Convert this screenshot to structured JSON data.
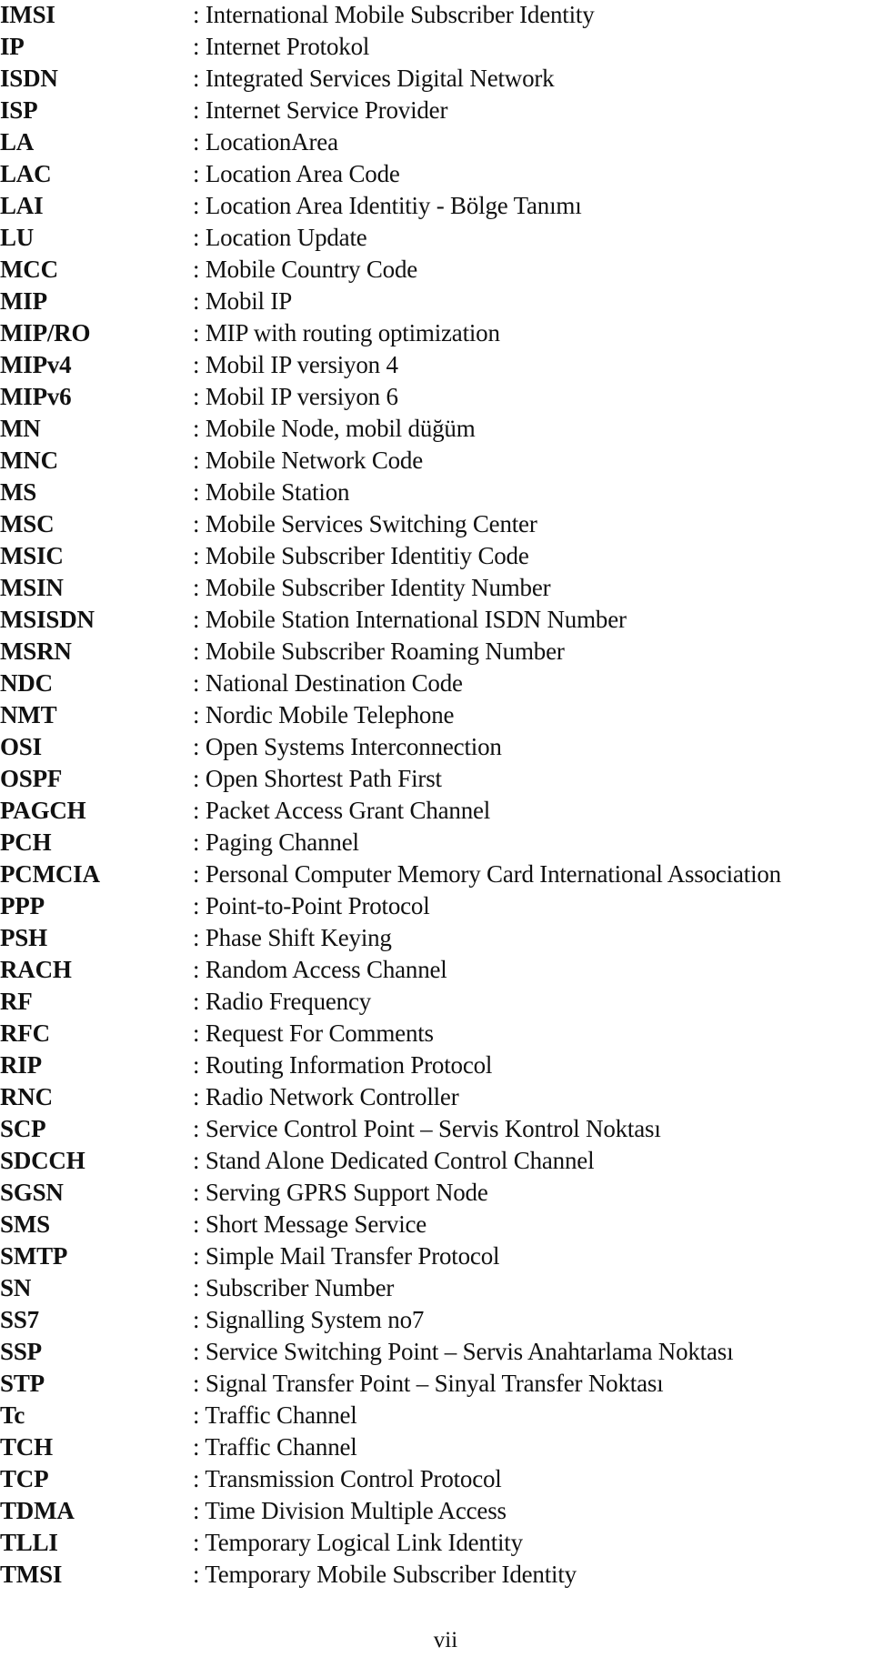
{
  "entries": [
    {
      "abbr": "IMSI",
      "def": ": International Mobile Subscriber Identity"
    },
    {
      "abbr": "IP",
      "def": ": Internet Protokol"
    },
    {
      "abbr": "ISDN",
      "def": ": Integrated Services Digital Network"
    },
    {
      "abbr": "ISP",
      "def": ": Internet Service Provider"
    },
    {
      "abbr": "LA",
      "def": ": LocationArea"
    },
    {
      "abbr": "LAC",
      "def": ": Location Area Code"
    },
    {
      "abbr": "LAI",
      "def": ": Location Area Identitiy -  Bölge Tanımı"
    },
    {
      "abbr": "LU",
      "def": ": Location Update"
    },
    {
      "abbr": "MCC",
      "def": ": Mobile Country Code"
    },
    {
      "abbr": "MIP",
      "def": ": Mobil IP"
    },
    {
      "abbr": "MIP/RO",
      "def": ": MIP with routing optimization"
    },
    {
      "abbr": "MIPv4",
      "def": ": Mobil IP versiyon 4"
    },
    {
      "abbr": "MIPv6",
      "def": ": Mobil IP versiyon 6"
    },
    {
      "abbr": "MN",
      "def": ": Mobile Node, mobil düğüm"
    },
    {
      "abbr": "MNC",
      "def": ": Mobile Network Code"
    },
    {
      "abbr": "MS",
      "def": ": Mobile Station"
    },
    {
      "abbr": "MSC",
      "def": ": Mobile Services Switching Center"
    },
    {
      "abbr": "MSIC",
      "def": ": Mobile Subscriber Identitiy Code"
    },
    {
      "abbr": "MSIN",
      "def": ": Mobile Subscriber Identity Number"
    },
    {
      "abbr": "MSISDN",
      "def": ": Mobile Station International ISDN Number"
    },
    {
      "abbr": "MSRN",
      "def": ": Mobile Subscriber Roaming Number"
    },
    {
      "abbr": "NDC",
      "def": ": National Destination Code"
    },
    {
      "abbr": "NMT",
      "def": ": Nordic Mobile Telephone"
    },
    {
      "abbr": "OSI",
      "def": ": Open Systems Interconnection"
    },
    {
      "abbr": "OSPF",
      "def": ": Open Shortest Path First"
    },
    {
      "abbr": "PAGCH",
      "def": ": Packet Access Grant Channel"
    },
    {
      "abbr": "PCH",
      "def": ": Paging Channel"
    },
    {
      "abbr": "PCMCIA",
      "def": ": Personal Computer Memory Card International Association"
    },
    {
      "abbr": "PPP",
      "def": ": Point-to-Point Protocol"
    },
    {
      "abbr": "PSH",
      "def": ": Phase Shift Keying"
    },
    {
      "abbr": "RACH",
      "def": ": Random Access Channel"
    },
    {
      "abbr": "RF",
      "def": ": Radio Frequency"
    },
    {
      "abbr": "RFC",
      "def": ":  Request For Comments"
    },
    {
      "abbr": "RIP",
      "def": ": Routing Information Protocol"
    },
    {
      "abbr": "RNC",
      "def": ": Radio Network Controller"
    },
    {
      "abbr": "SCP",
      "def": ": Service Control Point – Servis Kontrol Noktası"
    },
    {
      "abbr": "SDCCH",
      "def": ": Stand Alone Dedicated Control Channel"
    },
    {
      "abbr": "SGSN",
      "def": ": Serving GPRS Support Node"
    },
    {
      "abbr": "SMS",
      "def": ": Short Message Service"
    },
    {
      "abbr": "SMTP",
      "def": ": Simple Mail Transfer Protocol"
    },
    {
      "abbr": "SN",
      "def": ": Subscriber Number"
    },
    {
      "abbr": "SS7",
      "def": ": Signalling System no7"
    },
    {
      "abbr": "SSP",
      "def": ": Service Switching Point – Servis Anahtarlama Noktası"
    },
    {
      "abbr": "STP",
      "def": ": Signal Transfer Point – Sinyal Transfer Noktası"
    },
    {
      "abbr": "Tc",
      "def": ": Traffic Channel"
    },
    {
      "abbr": "TCH",
      "def": ": Traffic Channel"
    },
    {
      "abbr": "TCP",
      "def": ": Transmission Control Protocol"
    },
    {
      "abbr": "TDMA",
      "def": ": Time Division Multiple Access"
    },
    {
      "abbr": "TLLI",
      "def": ": Temporary Logical Link Identity"
    },
    {
      "abbr": "TMSI",
      "def": ": Temporary Mobile Subscriber Identity"
    }
  ],
  "page_number": "vii"
}
